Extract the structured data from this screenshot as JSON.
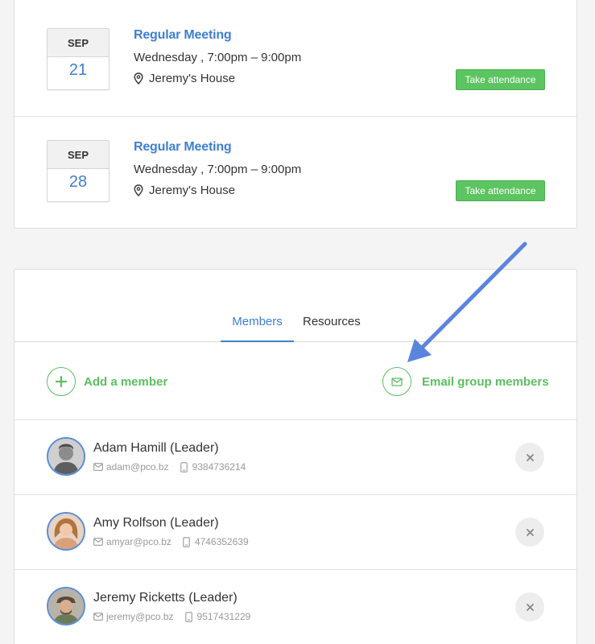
{
  "events": [
    {
      "month": "SEP",
      "day": "21",
      "title": "Regular Meeting",
      "time": "Wednesday ,  7:00pm – 9:00pm",
      "location": "Jeremy's House",
      "action": "Take attendance"
    },
    {
      "month": "SEP",
      "day": "28",
      "title": "Regular Meeting",
      "time": "Wednesday ,  7:00pm – 9:00pm",
      "location": "Jeremy's House",
      "action": "Take attendance"
    }
  ],
  "tabs": {
    "members": "Members",
    "resources": "Resources"
  },
  "actions": {
    "add": "Add a member",
    "email": "Email group members"
  },
  "members": [
    {
      "name": "Adam Hamill (Leader)",
      "email": "adam@pco.bz",
      "phone": "9384736214"
    },
    {
      "name": "Amy Rolfson (Leader)",
      "email": "amyar@pco.bz",
      "phone": "4746352639"
    },
    {
      "name": "Jeremy Ricketts (Leader)",
      "email": "jeremy@pco.bz",
      "phone": "9517431229"
    }
  ],
  "colors": {
    "accent": "#3f7fd0",
    "green": "#5cbf60",
    "arrow": "#5b84de"
  }
}
